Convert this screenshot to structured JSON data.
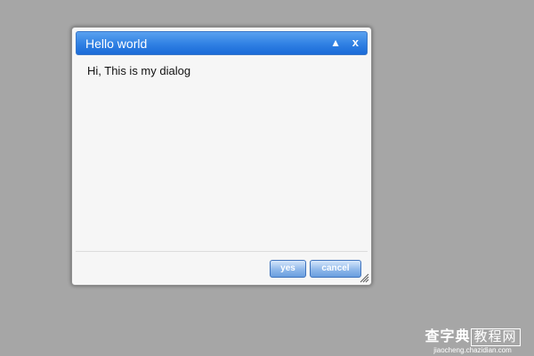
{
  "dialog": {
    "title": "Hello world",
    "collapse_icon": "▲",
    "close_icon": "x",
    "message": "Hi, This is my dialog",
    "buttons": {
      "yes_label": "yes",
      "cancel_label": "cancel"
    }
  },
  "watermark": {
    "logo_main": "查字典",
    "logo_box": "教程网",
    "url": "jiaocheng.chazidian.com"
  },
  "colors": {
    "background": "#a6a6a6",
    "titlebar": "#2f80e3",
    "button": "#8fb8ea"
  }
}
